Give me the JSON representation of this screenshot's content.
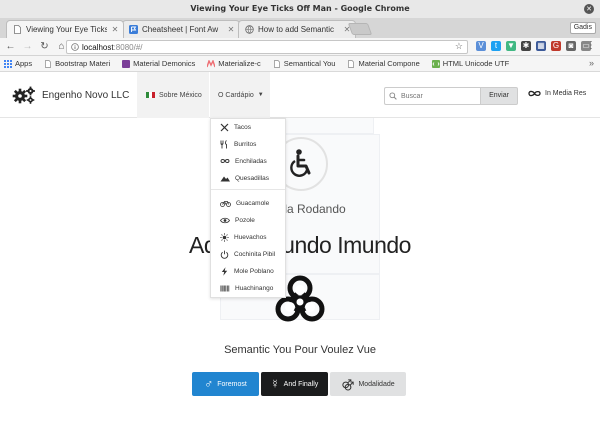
{
  "window": {
    "title": "Viewing Your Eye Ticks Off Man - Google Chrome",
    "profile": "Gadis"
  },
  "tabs": [
    {
      "label": "Viewing Your Eye Ticks",
      "active": true
    },
    {
      "label": "Cheatsheet | Font Aw",
      "active": false
    },
    {
      "label": "How to add Semantic",
      "active": false
    }
  ],
  "address": {
    "host": "localhost",
    "path": ":8080/#/"
  },
  "bookmarks": [
    {
      "label": "Apps",
      "icon": "apps-grid-icon",
      "color": "#4285f4"
    },
    {
      "label": "Bootstrap Materi",
      "icon": "page-icon",
      "color": "#888888"
    },
    {
      "label": "Material Demonics",
      "icon": "bookmark-favicon",
      "color": "#7b3f98"
    },
    {
      "label": "Materialize-c",
      "icon": "materialize-favicon",
      "color": "#ee6e73"
    },
    {
      "label": "Semantical You",
      "icon": "page-icon",
      "color": "#888888"
    },
    {
      "label": "Material Compone",
      "icon": "page-icon",
      "color": "#888888"
    },
    {
      "label": "HTML Unicode UTF",
      "icon": "html-favicon",
      "color": "#6ab04c"
    }
  ],
  "navbar": {
    "brand": "Engenho Novo LLC",
    "sobre": "Sobre México",
    "cardapio": "O Cardápio",
    "search_placeholder": "Buscar",
    "send_label": "Enviar",
    "inmedia_label": "In Media Res"
  },
  "menu": {
    "items": [
      {
        "label": "Tacos",
        "icon": "utensils-icon"
      },
      {
        "label": "Burritos",
        "icon": "fork-knife-icon"
      },
      {
        "label": "Enchiladas",
        "icon": "infinity-icon"
      },
      {
        "label": "Quesadillas",
        "icon": "mountain-icon"
      },
      {
        "label": "Guacamole",
        "icon": "bicycle-icon"
      },
      {
        "label": "Pozole",
        "icon": "eye-icon"
      },
      {
        "label": "Huevachos",
        "icon": "sun-icon"
      },
      {
        "label": "Cochinita Pibil",
        "icon": "power-icon"
      },
      {
        "label": "Mole Poblano",
        "icon": "bolt-icon"
      },
      {
        "label": "Huachinango",
        "icon": "barcode-icon"
      }
    ]
  },
  "main": {
    "wheel_title": "A Roda Rodando",
    "heading": "Adeus, Mundo Imundo",
    "subtitle": "Semantic You Pour Voulez Vue",
    "buttons": [
      {
        "label": "Foremost",
        "symbol": "♂",
        "color": "#2185d0"
      },
      {
        "label": "And Finally",
        "symbol": "☿",
        "color": "#1b1c1d"
      },
      {
        "label": "Modalidade",
        "symbol": "⚣",
        "color": "#e0e1e2"
      }
    ]
  }
}
